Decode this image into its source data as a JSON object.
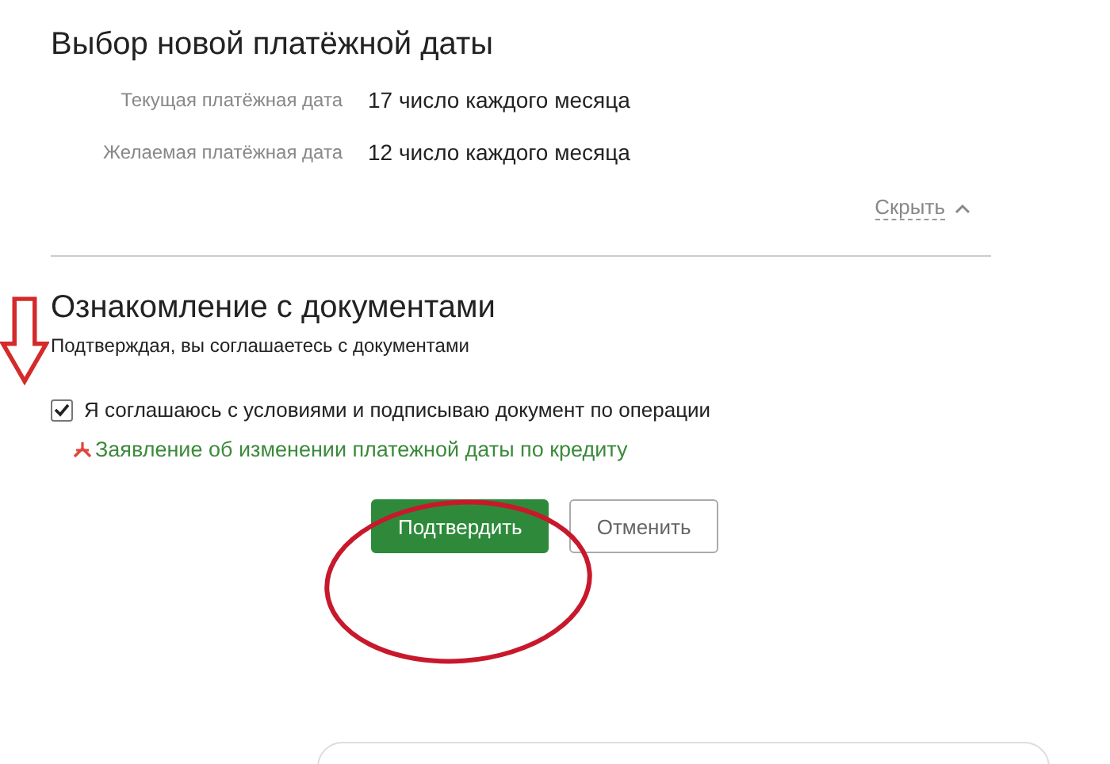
{
  "date_section": {
    "title": "Выбор новой платёжной даты",
    "fields": [
      {
        "label": "Текущая платёжная дата",
        "value": "17 число каждого месяца"
      },
      {
        "label": "Желаемая платёжная дата",
        "value": "12 число каждого месяца"
      }
    ],
    "collapse_link": "Скрыть"
  },
  "documents_section": {
    "title": "Ознакомление с документами",
    "subtitle": "Подтверждая, вы соглашаетесь с документами",
    "agreement": {
      "label": "Я соглашаюсь с условиями и подписываю документ по операции",
      "checked": true
    },
    "document_link": "Заявление об изменении платежной даты по кредиту"
  },
  "buttons": [
    {
      "label": "Подтвердить",
      "kind": "primary"
    },
    {
      "label": "Отменить",
      "kind": "secondary"
    }
  ]
}
